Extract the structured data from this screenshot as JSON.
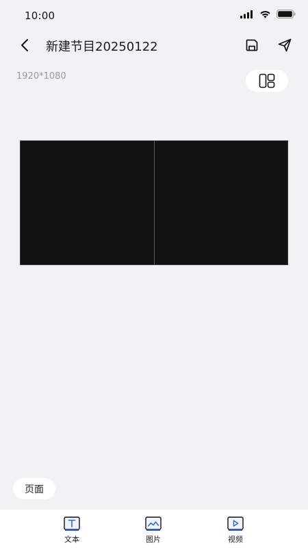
{
  "status_bar": {
    "time": "10:00"
  },
  "header": {
    "title": "新建节目20250122"
  },
  "canvas_info": {
    "resolution": "1920*1080"
  },
  "page_button": {
    "label": "页面"
  },
  "toolbar": {
    "items": [
      {
        "label": "文本",
        "icon": "text-icon"
      },
      {
        "label": "图片",
        "icon": "image-icon"
      },
      {
        "label": "视频",
        "icon": "video-icon"
      }
    ]
  },
  "colors": {
    "background": "#f1f2f4",
    "canvas": "#121212",
    "accent": "#3b66c4"
  }
}
